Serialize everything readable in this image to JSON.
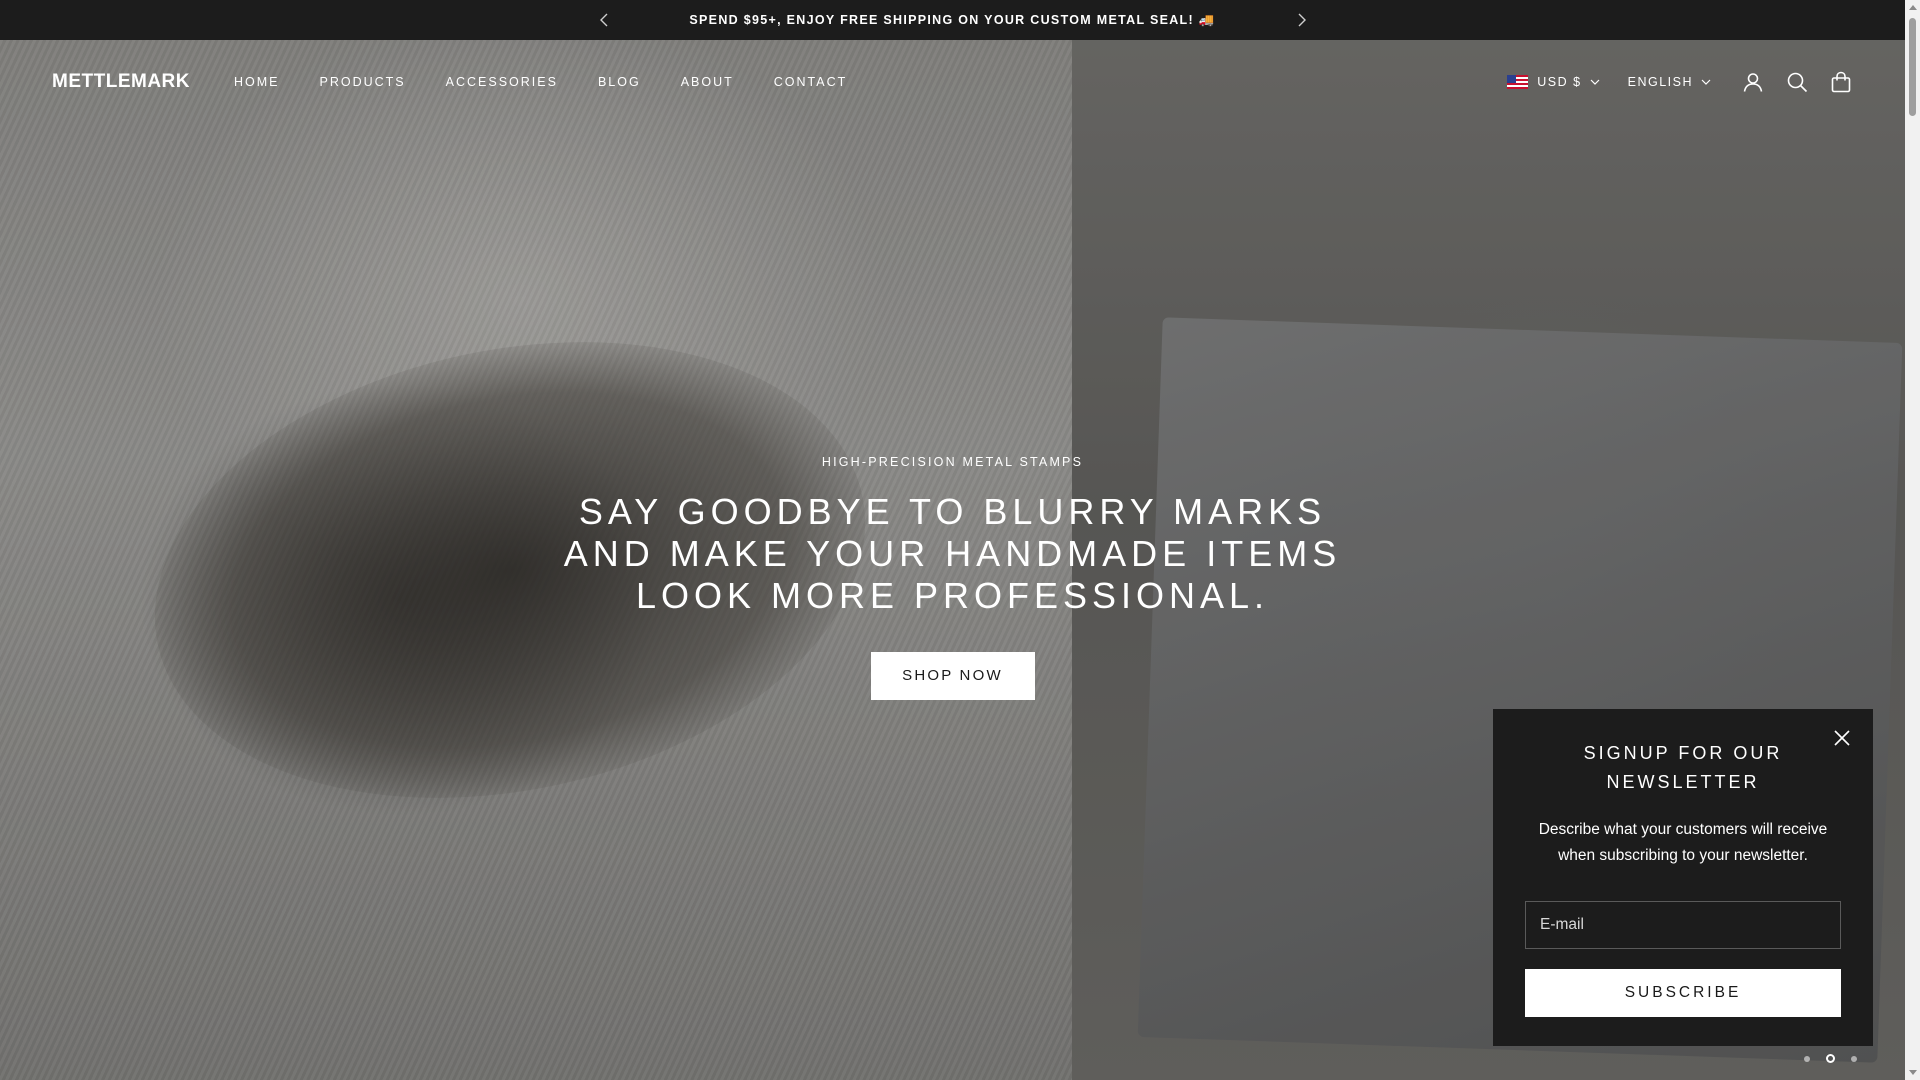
{
  "announcement": {
    "text": "SPEND $95+, ENJOY FREE SHIPPING ON YOUR CUSTOM METAL SEAL! 🚚",
    "prev_icon": "chevron-left-icon",
    "next_icon": "chevron-right-icon"
  },
  "header": {
    "logo": "METTLEMARK",
    "nav": [
      "HOME",
      "PRODUCTS",
      "ACCESSORIES",
      "BLOG",
      "ABOUT",
      "CONTACT"
    ],
    "currency": "USD $",
    "language": "ENGLISH",
    "icons": [
      "account-icon",
      "search-icon",
      "cart-icon"
    ]
  },
  "hero": {
    "eyebrow": "HIGH-PRECISION METAL STAMPS",
    "headline_lines": [
      "SAY GOODBYE TO BLURRY MARKS",
      "AND MAKE YOUR HANDMADE ITEMS",
      "LOOK MORE PROFESSIONAL."
    ],
    "cta": "SHOP NOW",
    "slides_total": 3,
    "active_slide": 2
  },
  "newsletter": {
    "title_lines": [
      "SIGNUP FOR OUR",
      "NEWSLETTER"
    ],
    "description": "Describe what your customers will receive when subscribing to your newsletter.",
    "email_placeholder": "E-mail",
    "subscribe_label": "SUBSCRIBE"
  },
  "colors": {
    "bar_bg": "#1c1c1c",
    "popup_bg": "#1c1c1c",
    "button_bg": "#ffffff",
    "text_light": "#ffffff"
  }
}
